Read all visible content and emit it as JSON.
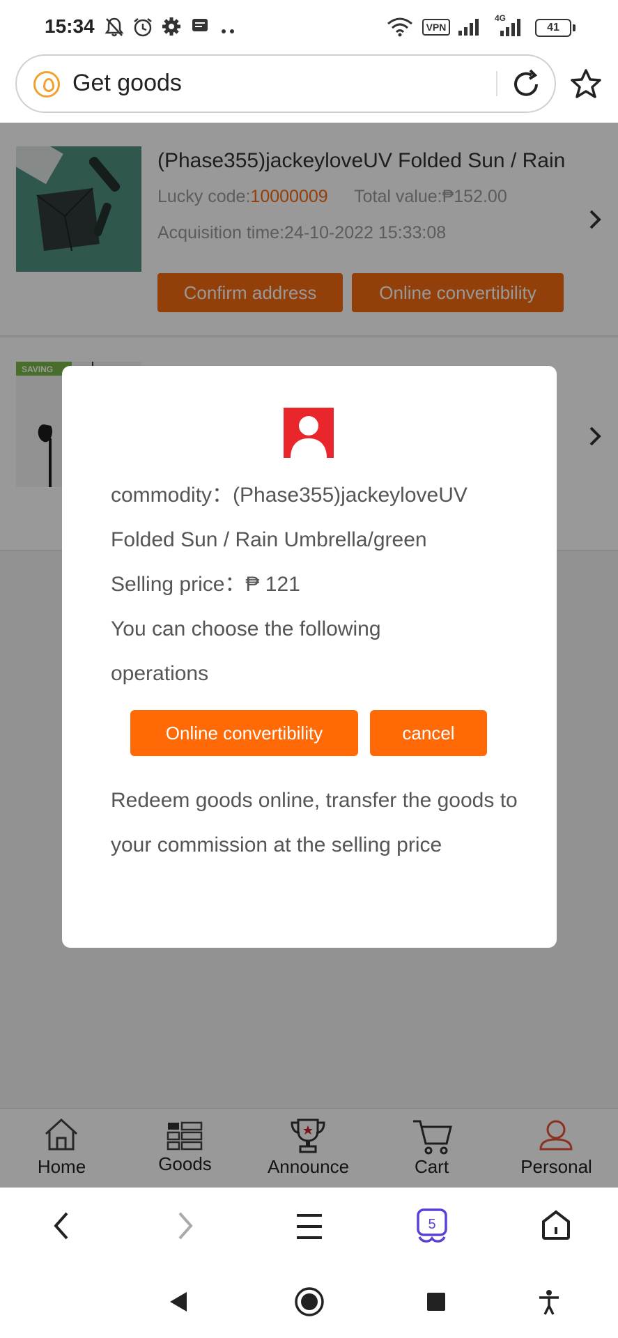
{
  "status_bar": {
    "time": "15:34",
    "icons": [
      "bell-off-icon",
      "alarm-icon",
      "gear-icon",
      "message-icon",
      "more-dots-icon",
      "wifi-icon",
      "vpn-icon",
      "signal-icon",
      "signal-4g-icon",
      "battery-icon"
    ],
    "vpn_label": "VPN",
    "network_label": "4G",
    "battery_level": "41"
  },
  "address_bar": {
    "title": "Get goods",
    "site_icon": "droplet-icon",
    "reload_icon": "reload-icon",
    "bookmark_icon": "star-icon"
  },
  "orders": [
    {
      "title": "(Phase355)jackeyloveUV Folded Sun / Rain",
      "lucky_code_label": "Lucky code:",
      "lucky_code": "10000009",
      "total_value_label": "Total value:",
      "total_value": "₱152.00",
      "acquisition_label": "Acquisition time:",
      "acquisition_time": "24-10-2022 15:33:08",
      "buttons": [
        "Confirm address",
        "Online convertibility"
      ],
      "thumb_text": ""
    },
    {
      "title": "",
      "thumb_text": "SAVING"
    }
  ],
  "modal": {
    "commodity_label": "commodity：",
    "commodity_name": "(Phase355)jackeyloveUV Folded Sun / Rain Umbrella/green",
    "price_label": "Selling price：",
    "price_value": "₱ 121",
    "prompt": "You can choose the following operations",
    "primary_button": "Online convertibility",
    "cancel_button": "cancel",
    "description": "Redeem goods online, transfer the goods to your commission at the selling price",
    "avatar_color": "#e8262b"
  },
  "tabbar": {
    "items": [
      {
        "label": "Home",
        "icon": "home-icon"
      },
      {
        "label": "Goods",
        "icon": "grid-list-icon"
      },
      {
        "label": "Announce",
        "icon": "trophy-icon"
      },
      {
        "label": "Cart",
        "icon": "cart-icon"
      },
      {
        "label": "Personal",
        "icon": "person-icon",
        "active": true
      }
    ],
    "active_color": "#e8533a"
  },
  "browser_bar": {
    "tab_count": "5",
    "icons": [
      "back-icon",
      "forward-icon",
      "menu-icon",
      "tabs-icon",
      "home-icon"
    ]
  },
  "system_nav": {
    "icons": [
      "nav-back-icon",
      "nav-home-icon",
      "nav-recents-icon",
      "accessibility-icon"
    ]
  },
  "colors": {
    "accent": "#f36a10",
    "modal_button": "#ff6a06",
    "overlay": "rgba(0,0,0,0.4)"
  }
}
